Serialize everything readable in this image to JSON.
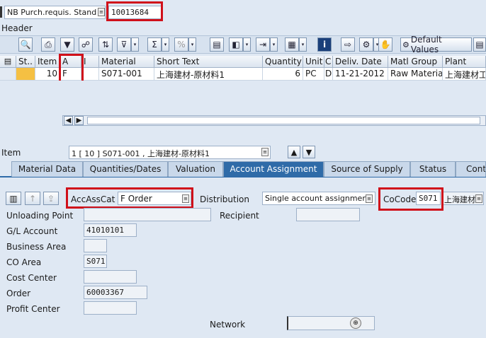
{
  "top": {
    "doc_type": "NB Purch.requis. Stand",
    "doc_number": "10013684",
    "header_label": "Header"
  },
  "toolbar": {
    "default_values_label": "Default Values"
  },
  "table": {
    "headers": [
      "St..",
      "Item",
      "A",
      "I",
      "Material",
      "Short Text",
      "Quantity",
      "Unit",
      "C",
      "Deliv. Date",
      "Matl Group",
      "Plant"
    ],
    "row": [
      "",
      "10",
      "F",
      "",
      "S071-001",
      "上海建材-原材料1",
      "6",
      "PC",
      "D",
      "11-21-2012",
      "Raw Material",
      "上海建材工"
    ]
  },
  "item_nav": {
    "label": "Item",
    "value": "1 [ 10 ] S071-001 , 上海建材-原材料1"
  },
  "tabs": [
    "Material Data",
    "Quantities/Dates",
    "Valuation",
    "Account Assignment",
    "Source of Supply",
    "Status",
    "Conta"
  ],
  "account": {
    "acc_ass_cat_label": "AccAssCat",
    "acc_ass_cat_value": "F Order",
    "distribution_label": "Distribution",
    "distribution_value": "Single account assignmer",
    "cocode_label": "CoCode",
    "cocode_value": "S071",
    "cocode_desc": "上海建材",
    "unloading_point_label": "Unloading Point",
    "recipient_label": "Recipient",
    "gl_account_label": "G/L Account",
    "gl_account_value": "41010101",
    "business_area_label": "Business Area",
    "co_area_label": "CO Area",
    "co_area_value": "S071",
    "cost_center_label": "Cost Center",
    "order_label": "Order",
    "order_value": "60003367",
    "profit_center_label": "Profit Center",
    "network_label": "Network"
  }
}
